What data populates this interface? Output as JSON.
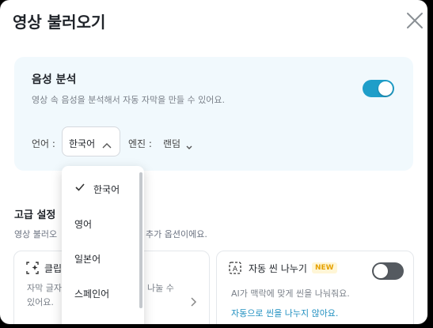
{
  "dialog": {
    "title": "영상 불러오기"
  },
  "voice": {
    "title": "음성 분석",
    "description": "영상 속 음성을 분석해서 자동 자막을 만들 수 있어요.",
    "enabled": true,
    "language_label": "언어 :",
    "language_value": "한국어",
    "engine_label": "엔진 :",
    "engine_value": "랜덤"
  },
  "language_dropdown": {
    "options": [
      "한국어",
      "영어",
      "일본어",
      "스페인어"
    ],
    "selected": "한국어"
  },
  "advanced": {
    "title": "고급 설정",
    "description_part1": "영상 불러오",
    "description_part2": "추가 옵션이에요.",
    "clip_card": {
      "title": "클립",
      "desc_line1": "자막 글자",
      "desc_line1_right": "나눌 수",
      "desc_line2": "있어요."
    },
    "scene_card": {
      "title": "자동 씬 나누기",
      "badge": "NEW",
      "description": "AI가 맥락에 맞게 씬을 나눠줘요.",
      "status": "자동으로 씬을 나누지 않아요.",
      "enabled": false
    }
  },
  "colors": {
    "accent": "#1f9ec9",
    "card_bg": "#f1f9fd",
    "badge": "#e6a100"
  },
  "icons": [
    "close-icon",
    "chevron-up-icon",
    "chevron-down-icon",
    "check-icon",
    "chevron-right-icon",
    "clip-sparkle-icon",
    "ai-scene-icon"
  ]
}
